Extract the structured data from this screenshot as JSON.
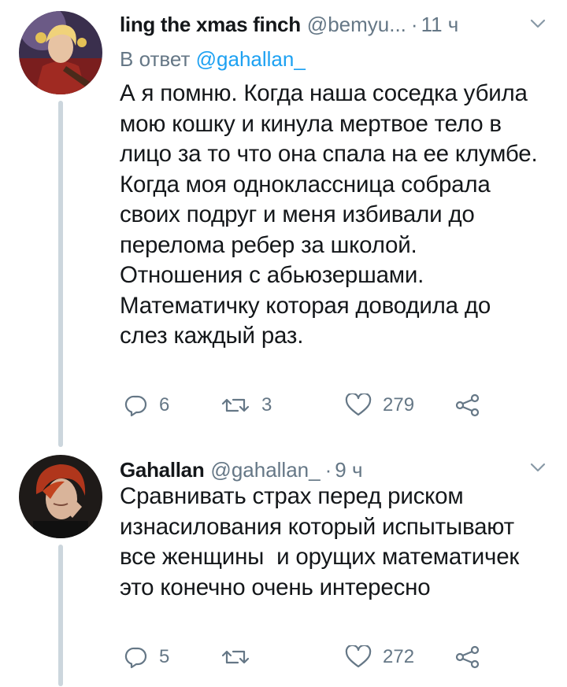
{
  "tweets": [
    {
      "name": "ling the xmas finch",
      "handle": "@bemyu...",
      "dot": "·",
      "time": "11 ч",
      "reply_prefix": "В ответ",
      "reply_mention": "@gahallan_",
      "lines": [
        "А я помню. Когда наша соседка убила",
        "мою кошку и кинула мертвое тело в",
        "лицо за то что она спала на ее клумбе.",
        "Когда моя одноклассница собрала",
        "своих подруг и меня избивали до",
        "перелома ребер за школой.",
        "Отношения с абьюзершами.",
        "Математичку которая доводила до",
        "слез каждый раз."
      ],
      "replies": "6",
      "retweets": "3",
      "likes": "279"
    },
    {
      "name": "Gahallan",
      "handle": "@gahallan_",
      "dot": "·",
      "time": "9 ч",
      "lines": [
        "Сравнивать страх перед риском",
        "изнасилования который испытывают",
        "все женщины  и орущих математичек",
        "это конечно очень интересно"
      ],
      "replies": "5",
      "retweets": "",
      "likes": "272"
    }
  ],
  "icons": [
    "reply-icon",
    "retweet-icon",
    "like-icon",
    "share-icon",
    "chevron-down-icon"
  ],
  "colors": {
    "text": "#14171a",
    "secondary": "#657786",
    "link": "#1da1f2",
    "thread_line": "#ccd6dd"
  }
}
